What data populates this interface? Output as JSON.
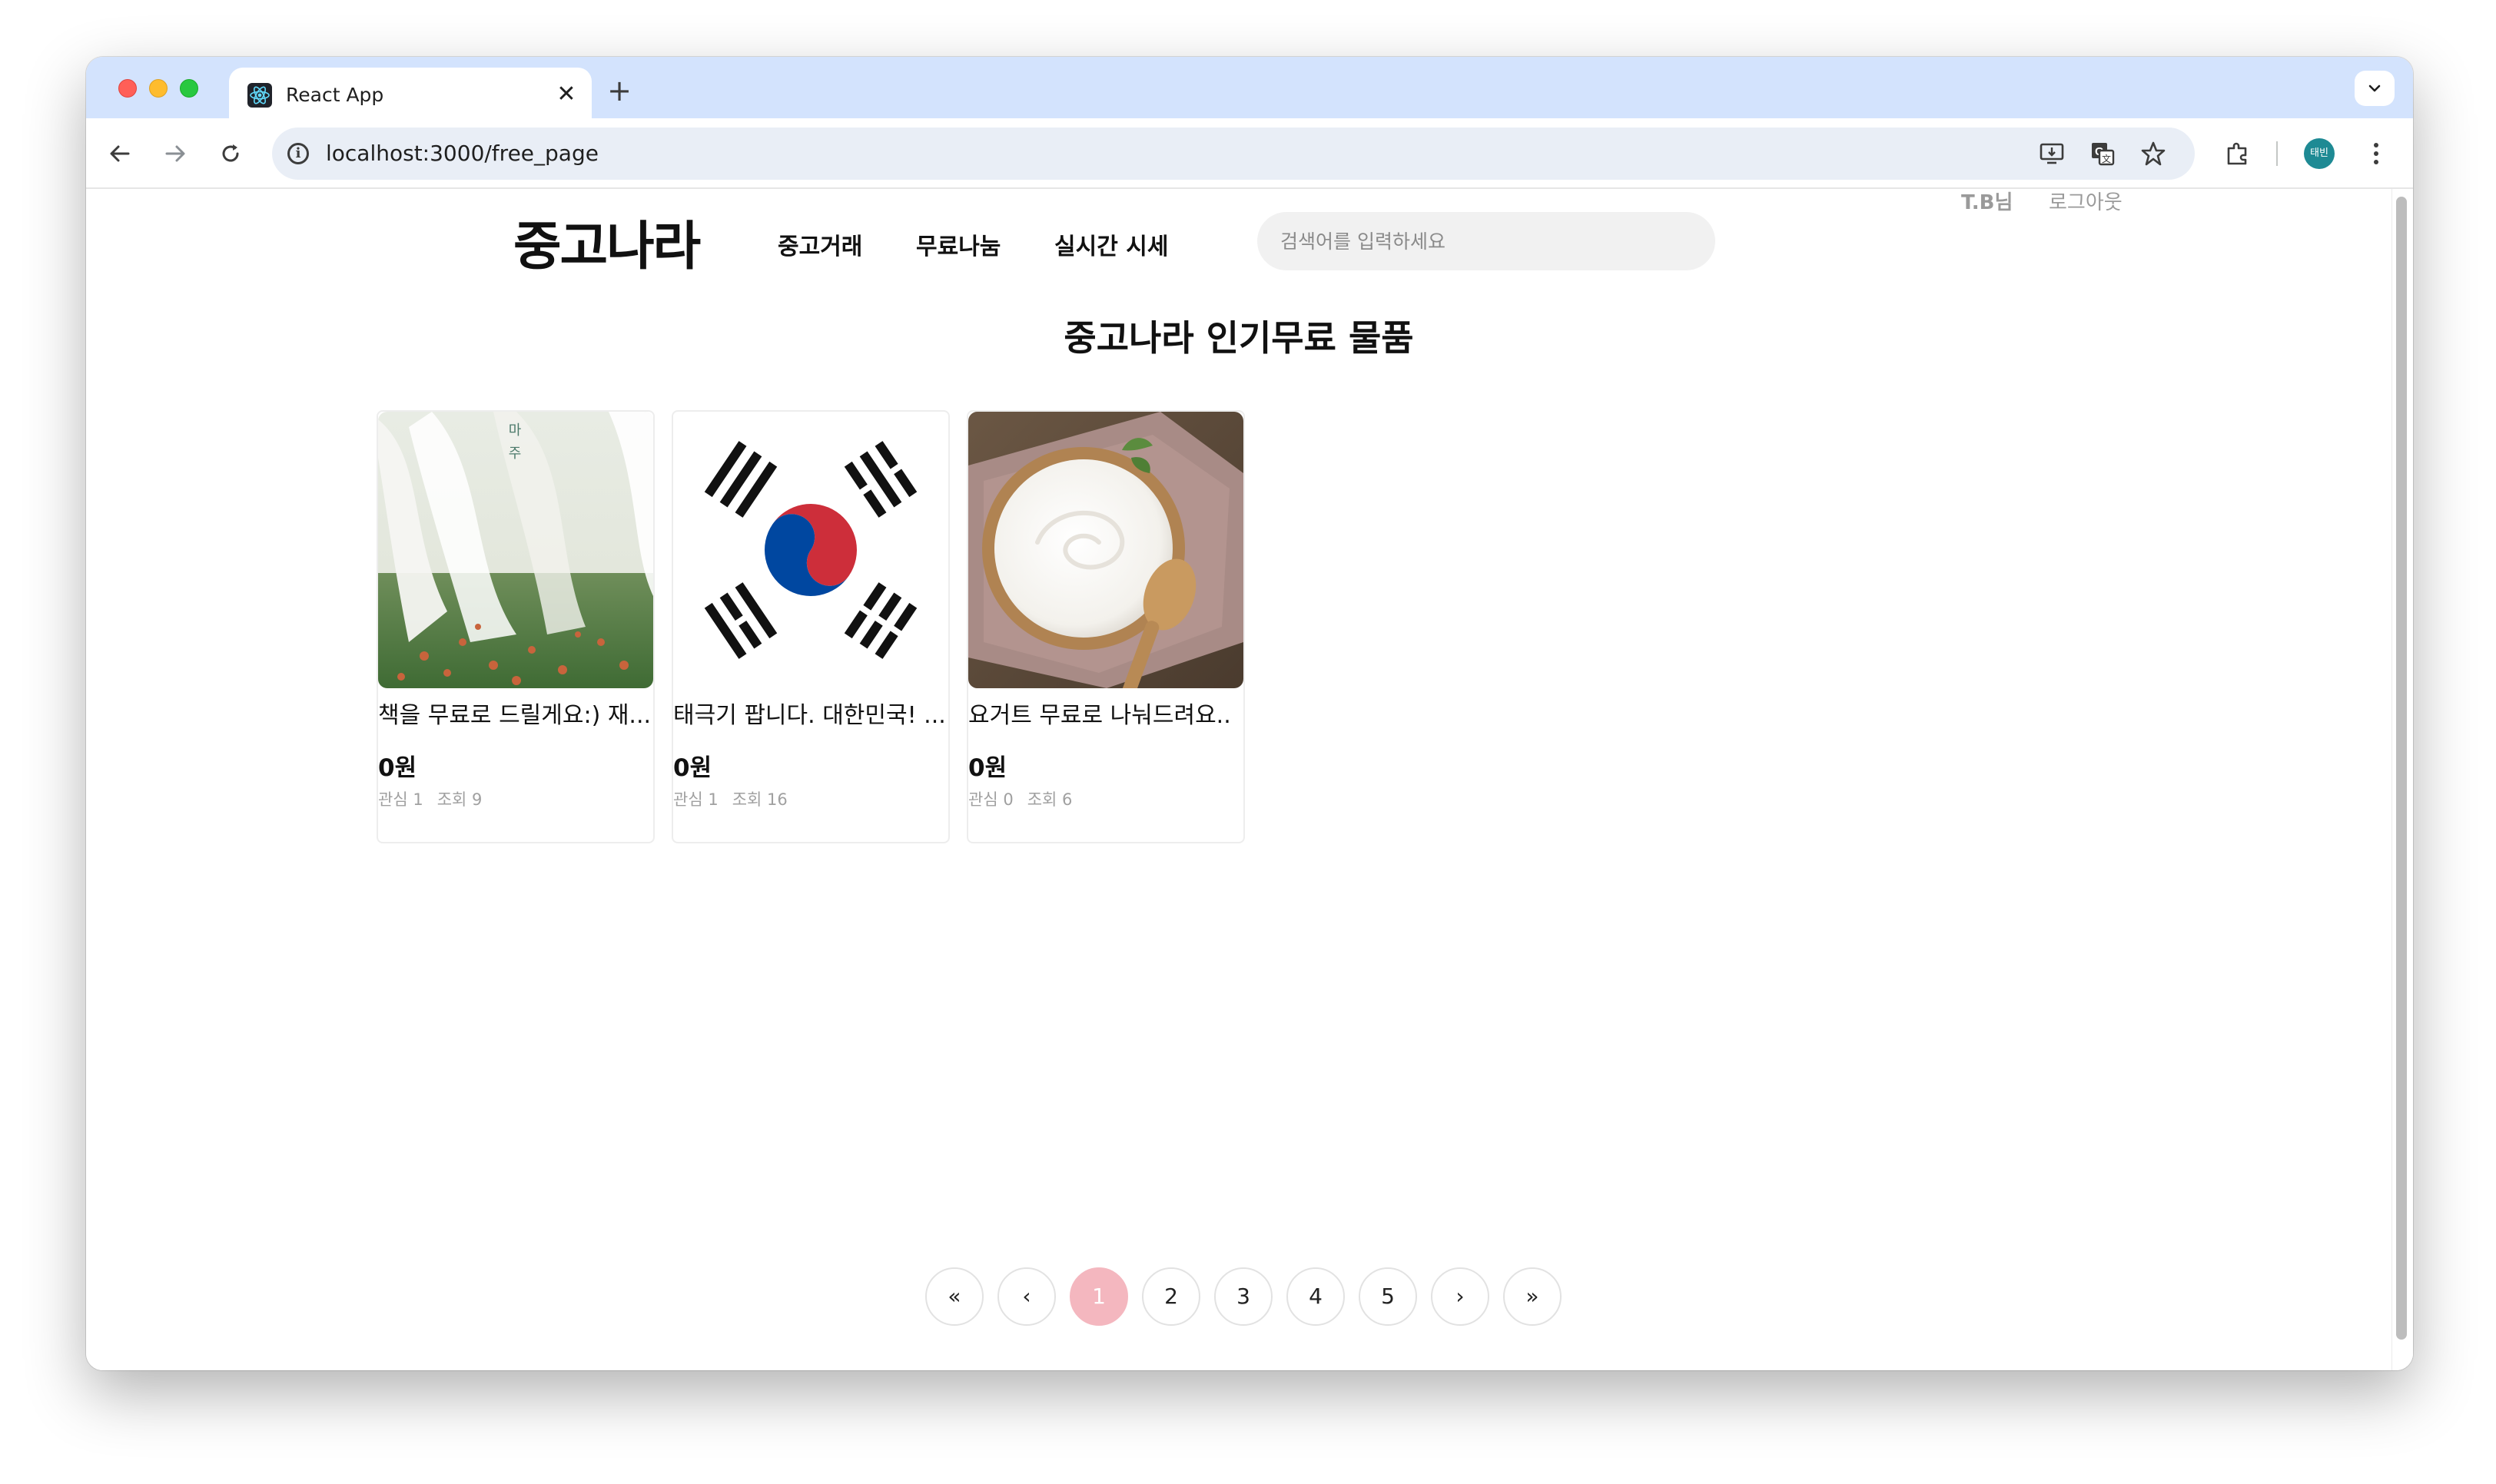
{
  "browser": {
    "tab_title": "React App",
    "tab_close": "✕",
    "new_tab": "+",
    "tabs_dropdown": "⌄",
    "url": "localhost:3000/free_page",
    "avatar_text": "태빈",
    "icons": [
      "back-arrow-icon",
      "forward-arrow-icon",
      "reload-icon",
      "site-info-icon",
      "install-app-icon",
      "translate-icon",
      "bookmark-star-icon",
      "extensions-icon",
      "more-menu-icon"
    ]
  },
  "header": {
    "logo": "중고나라",
    "nav": [
      "중고거래",
      "무료나눔",
      "실시간 시세"
    ],
    "search_placeholder": "검색어를 입력하세요",
    "user_name": "T.B님",
    "logout": "로그아웃"
  },
  "page": {
    "title": "중고나라 인기무료 물품"
  },
  "products": [
    {
      "title": "책을 무료로 드릴게요:) 재...",
      "price": "0원",
      "likes": "관심 1",
      "views": "조회 9",
      "image": "book-cover"
    },
    {
      "title": "태극기 팝니다. 대한민국! ...",
      "price": "0원",
      "likes": "관심 1",
      "views": "조회 16",
      "image": "korean-flag"
    },
    {
      "title": "요거트 무료로 나눠드려요..",
      "price": "0원",
      "likes": "관심 0",
      "views": "조회 6",
      "image": "yogurt-bowl"
    }
  ],
  "pagination": {
    "first": "«",
    "prev": "‹",
    "pages": [
      "1",
      "2",
      "3",
      "4",
      "5"
    ],
    "next": "›",
    "last": "»",
    "active_page": "1",
    "active_color": "#f4b7bf"
  },
  "colors": {
    "tabbar": "#d3e3fd",
    "omnibox": "#e9eef6",
    "search_bg": "#f1f1f1"
  }
}
